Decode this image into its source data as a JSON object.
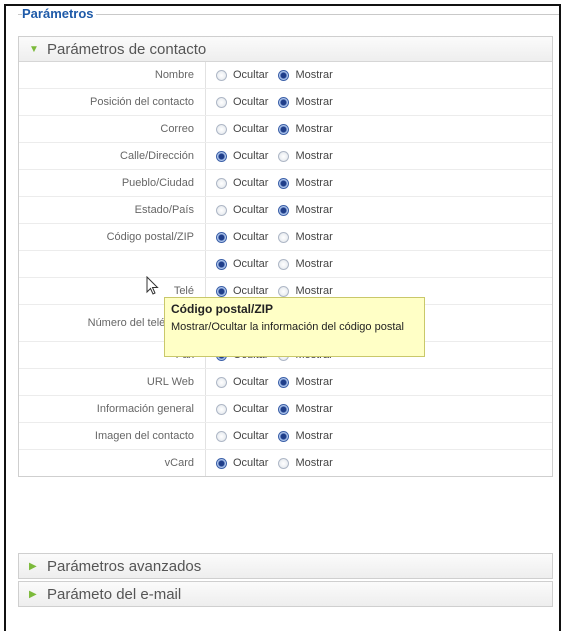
{
  "legend": "Parámetros",
  "contact_panel": {
    "title": "Parámetros de contacto",
    "hide_label": "Ocultar",
    "show_label": "Mostrar",
    "rows": [
      {
        "label": "Nombre",
        "value": "Mostrar"
      },
      {
        "label": "Posición del contacto",
        "value": "Mostrar"
      },
      {
        "label": "Correo",
        "value": "Mostrar"
      },
      {
        "label": "Calle/Dirección",
        "value": "Ocultar"
      },
      {
        "label": "Pueblo/Ciudad",
        "value": "Mostrar"
      },
      {
        "label": "Estado/País",
        "value": "Mostrar"
      },
      {
        "label": "Código postal/ZIP",
        "value": "Ocultar"
      },
      {
        "label": "",
        "value": "Ocultar"
      },
      {
        "label": "Telé",
        "value": "Ocultar"
      },
      {
        "label": "Número del telé móvil",
        "value": "Ocultar"
      },
      {
        "label": "Fax",
        "value": "Ocultar"
      },
      {
        "label": "URL Web",
        "value": "Mostrar"
      },
      {
        "label": "Información general",
        "value": "Mostrar"
      },
      {
        "label": "Imagen del contacto",
        "value": "Mostrar"
      },
      {
        "label": "vCard",
        "value": "Ocultar"
      }
    ]
  },
  "advanced_panel": {
    "title": "Parámetros avanzados"
  },
  "email_panel": {
    "title": "Parámeto del e-mail"
  },
  "tooltip": {
    "title": "Código postal/ZIP",
    "body": "Mostrar/Ocultar la información del código postal"
  },
  "icons": {
    "expanded": "triangle-down-icon",
    "collapsed": "triangle-right-icon",
    "pointer": "mouse-cursor-icon"
  }
}
